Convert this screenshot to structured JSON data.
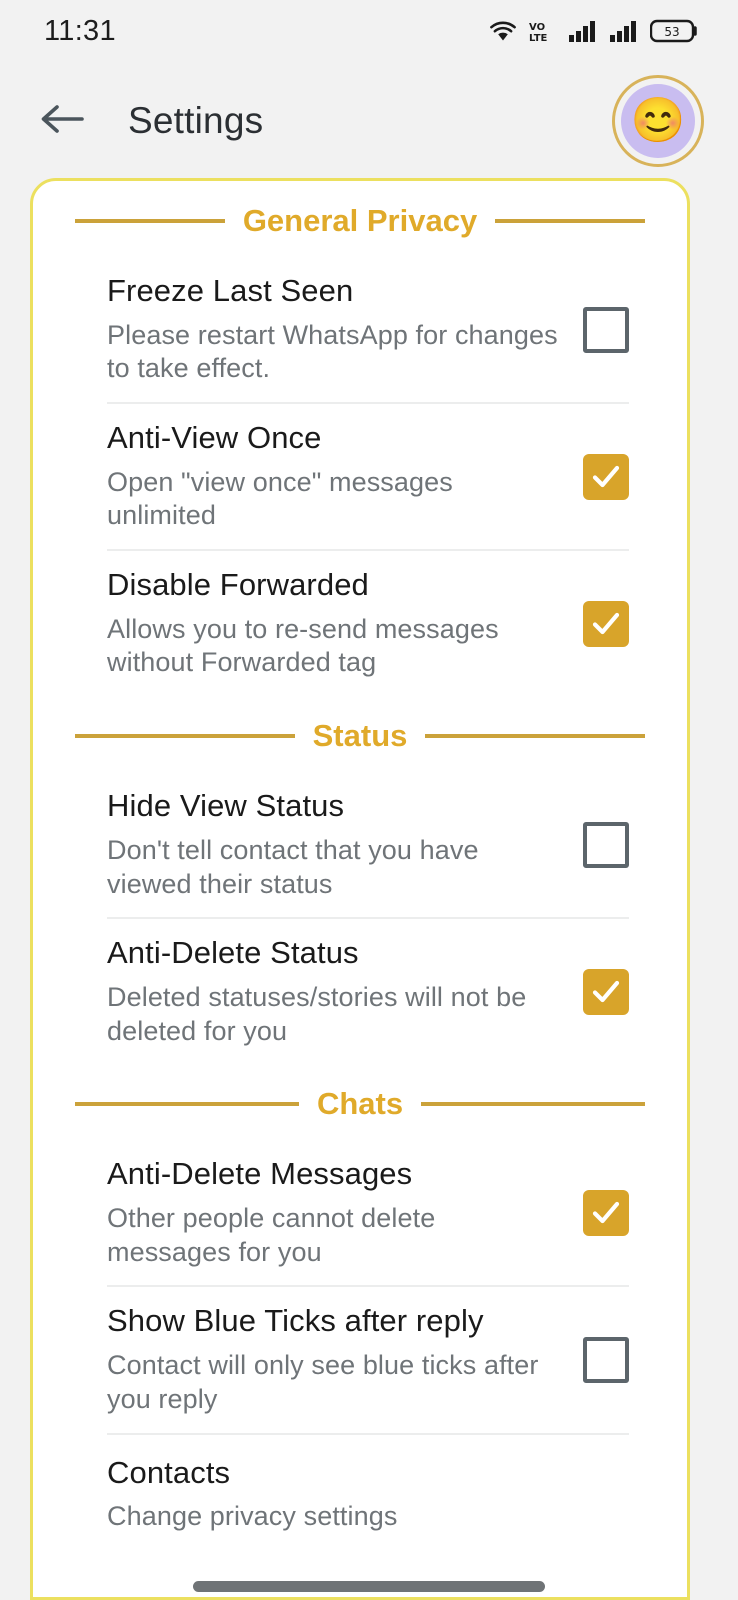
{
  "status_bar": {
    "time": "11:31",
    "battery_level": "53",
    "icons": [
      "wifi-icon",
      "volte-icon",
      "signal-bars-icon-1",
      "signal-bars-icon-2",
      "battery-icon"
    ]
  },
  "app_bar": {
    "back_label": "←",
    "title": "Settings",
    "avatar_emoji": "😊"
  },
  "theme": {
    "accent_gold": "#e0aa2a",
    "rule_gold": "#cba23a",
    "card_border": "#ece05f",
    "checkbox_on": "#d8a42a",
    "checkbox_off_border": "#5c656b",
    "label_color": "#1a1a1a",
    "desc_color": "#6f7478"
  },
  "sections": [
    {
      "title": "General Privacy",
      "items": [
        {
          "label": "Freeze Last Seen",
          "desc": "Please restart WhatsApp for changes to take effect.",
          "checked": false
        },
        {
          "label": "Anti-View Once",
          "desc": "Open \"view once\" messages unlimited",
          "checked": true
        },
        {
          "label": "Disable Forwarded",
          "desc": "Allows you to re-send messages without Forwarded tag",
          "checked": true
        }
      ]
    },
    {
      "title": "Status",
      "items": [
        {
          "label": "Hide View Status",
          "desc": "Don't tell contact that you have viewed their status",
          "checked": false
        },
        {
          "label": "Anti-Delete Status",
          "desc": "Deleted statuses/stories will not be deleted for you",
          "checked": true
        }
      ]
    },
    {
      "title": "Chats",
      "items": [
        {
          "label": "Anti-Delete Messages",
          "desc": "Other people cannot delete messages for you",
          "checked": true
        },
        {
          "label": "Show Blue Ticks after reply",
          "desc": "Contact will only see blue ticks after you reply",
          "checked": false
        },
        {
          "label": "Contacts",
          "desc": "Change privacy settings",
          "checked": null
        }
      ]
    }
  ]
}
